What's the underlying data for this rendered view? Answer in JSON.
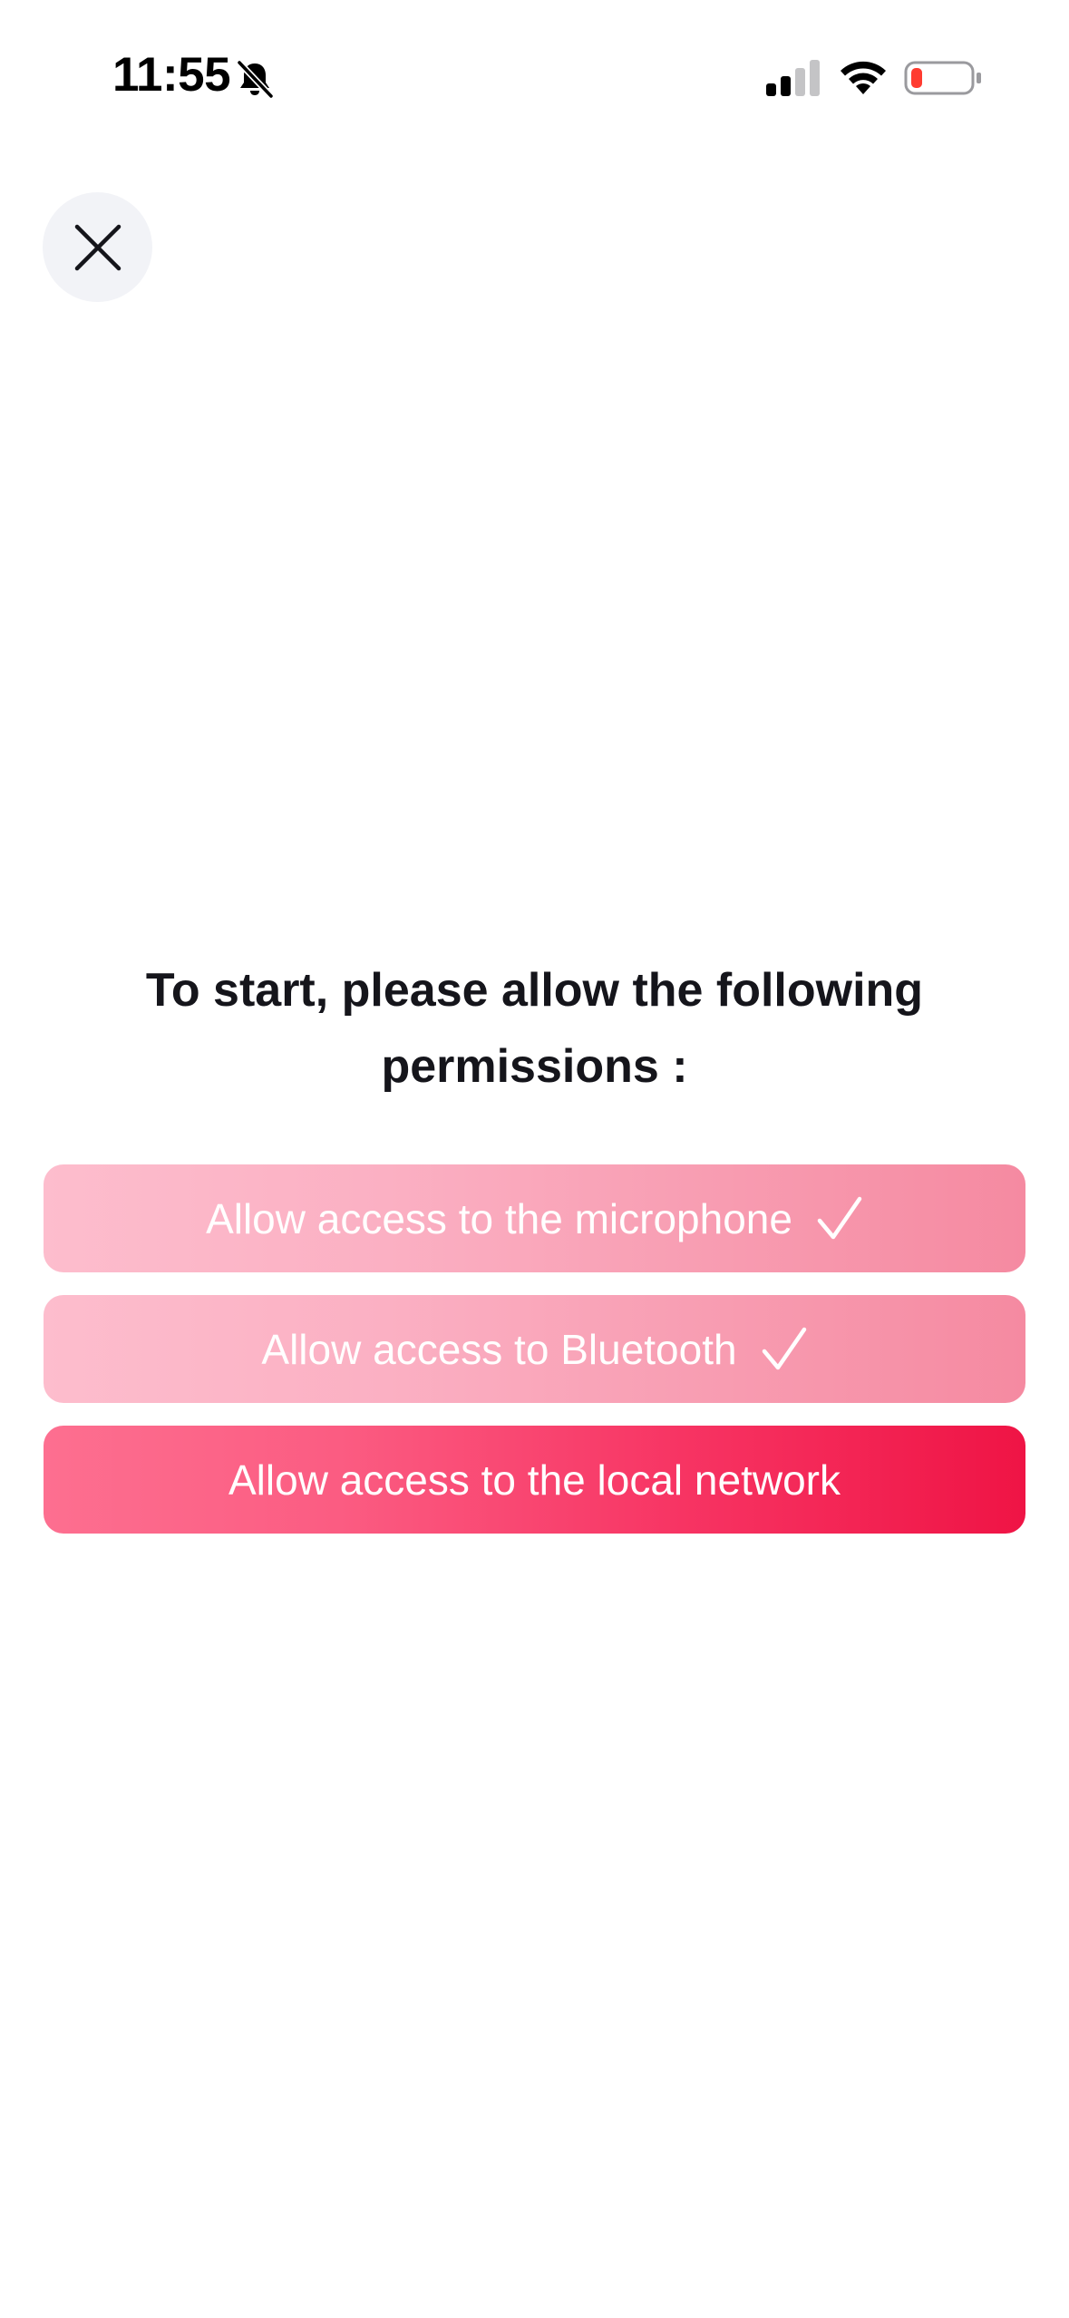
{
  "status_bar": {
    "time": "11:55",
    "silent_icon": "bell-slash-icon",
    "signal_icon": "cellular-signal-icon",
    "wifi_icon": "wifi-icon",
    "battery_icon": "battery-low-icon",
    "battery_color": "#ff3b30"
  },
  "close_button": {
    "icon": "close-icon"
  },
  "heading": {
    "text": "To start, please allow the following permissions :"
  },
  "permissions": [
    {
      "label": "Allow access to the microphone",
      "granted": true,
      "icon": "checkmark-icon"
    },
    {
      "label": "Allow access to Bluetooth",
      "granted": true,
      "icon": "checkmark-icon"
    },
    {
      "label": "Allow access to the local network",
      "granted": false
    }
  ],
  "colors": {
    "granted_start": "#fdbdcd",
    "granted_end": "#f58aa1",
    "pending_start": "#fd6f90",
    "pending_end": "#ef1445",
    "close_bg": "#f2f3f7",
    "text_dark": "#15151b"
  }
}
